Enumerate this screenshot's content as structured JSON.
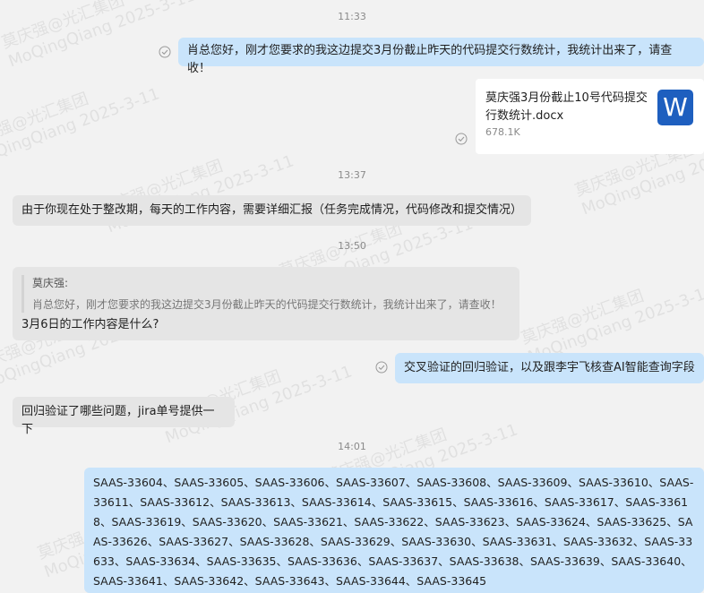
{
  "watermark": {
    "name": "莫庆强@光汇集团",
    "id": "MoQingQiang 2025-3-11"
  },
  "messages": {
    "t1": "11:33",
    "m1": "肖总您好，刚才您要求的我这边提交3月份截止昨天的代码提交行数统计，我统计出来了，请查收！",
    "file": {
      "name": "莫庆强3月份截止10号代码提交行数统计.docx",
      "size": "678.1K",
      "icon_letter": "W"
    },
    "t2": "13:37",
    "m2": "由于你现在处于整改期，每天的工作内容，需要详细汇报（任务完成情况，代码修改和提交情况）",
    "t3": "13:50",
    "quote_name": "莫庆强:",
    "quote_text": "肖总您好，刚才您要求的我这边提交3月份截止昨天的代码提交行数统计，我统计出来了，请查收！",
    "m3": "3月6日的工作内容是什么?",
    "m4": "交叉验证的回归验证，以及跟李宇飞核查AI智能查询字段",
    "m5": "回归验证了哪些问题，jira单号提供一下",
    "t4": "14:01",
    "m6": "SAAS-33604、SAAS-33605、SAAS-33606、SAAS-33607、SAAS-33608、SAAS-33609、SAAS-33610、SAAS-33611、SAAS-33612、SAAS-33613、SAAS-33614、SAAS-33615、SAAS-33616、SAAS-33617、SAAS-33618、SAAS-33619、SAAS-33620、SAAS-33621、SAAS-33622、SAAS-33623、SAAS-33624、SAAS-33625、SAAS-33626、SAAS-33627、SAAS-33628、SAAS-33629、SAAS-33630、SAAS-33631、SAAS-33632、SAAS-33633、SAAS-33634、SAAS-33635、SAAS-33636、SAAS-33637、SAAS-33638、SAAS-33639、SAAS-33640、SAAS-33641、SAAS-33642、SAAS-33643、SAAS-33644、SAAS-33645"
  }
}
